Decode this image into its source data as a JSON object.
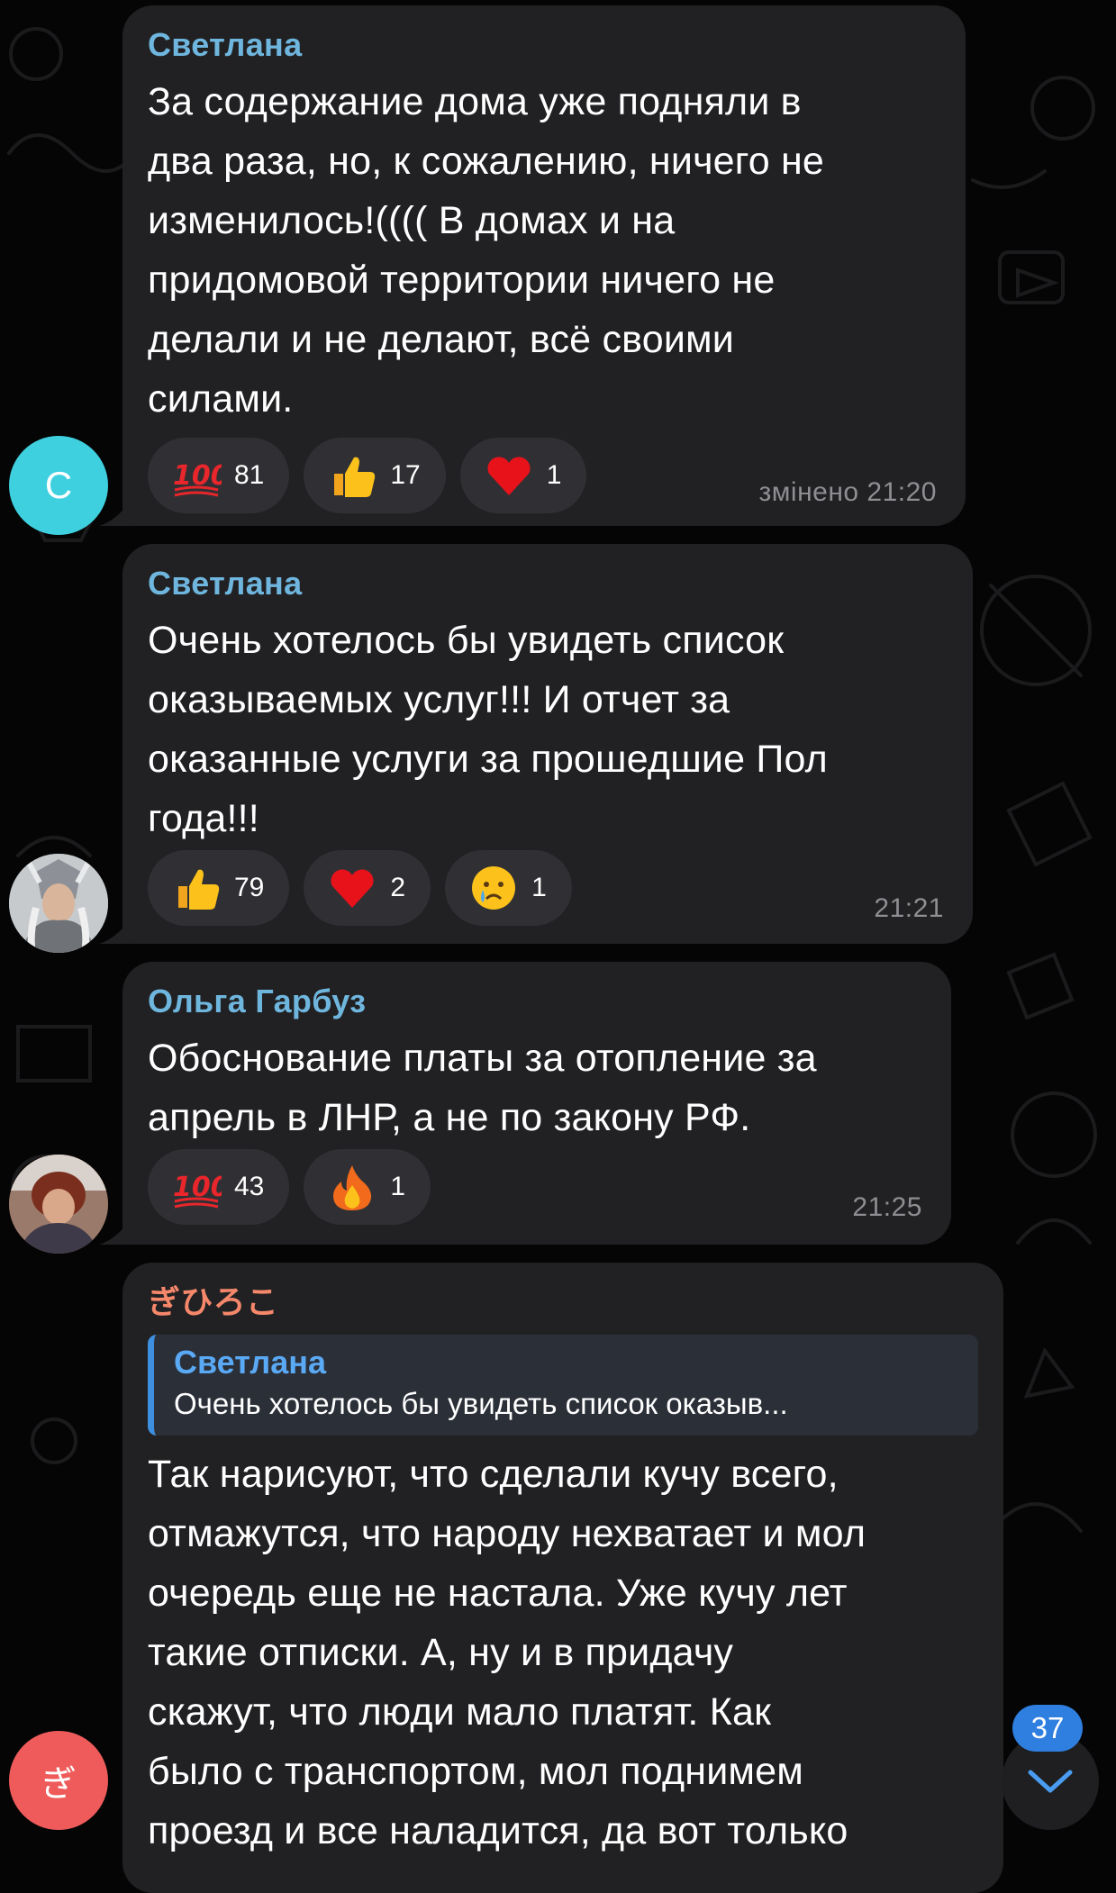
{
  "colors": {
    "background": "#050505",
    "bubble": "#212123",
    "reaction_pill": "#303034",
    "sender_blue": "#6fb6de",
    "sender_orange": "#f5876a",
    "reply_accent": "#3d8fe0",
    "badge": "#2f7fe0"
  },
  "messages": [
    {
      "sender": "Светлана",
      "sender_color": "#6fb6de",
      "lines": [
        "За содержание дома уже подняли в",
        "два раза, но, к сожалению, ничего не",
        "изменилось!(((( В домах и на",
        "придомовой территории ничего не",
        "делали и не делают, всё своими",
        "силами."
      ],
      "reactions": [
        {
          "emoji": "hundred-points-icon",
          "count": "81"
        },
        {
          "emoji": "thumbs-up-icon",
          "count": "17"
        },
        {
          "emoji": "red-heart-icon",
          "count": "1"
        }
      ],
      "time": "змінено 21:20",
      "avatar": {
        "type": "letter",
        "letter": "С",
        "color": "#3fd0e0"
      }
    },
    {
      "sender": "Светлана",
      "sender_color": "#6fb6de",
      "lines": [
        "Очень хотелось бы увидеть список",
        "оказываемых услуг!!! И отчет за",
        "оказанные услуги за прошедшие Пол",
        "года!!!"
      ],
      "reactions": [
        {
          "emoji": "thumbs-up-icon",
          "count": "79"
        },
        {
          "emoji": "red-heart-icon",
          "count": "2"
        },
        {
          "emoji": "crying-face-icon",
          "count": "1"
        }
      ],
      "time": "21:21",
      "avatar": {
        "type": "photo",
        "icon": "warrior-woman-avatar"
      }
    },
    {
      "sender": "Ольга Гарбуз",
      "sender_color": "#6fb6de",
      "lines": [
        "Обоснование платы за отопление за",
        "апрель в ЛНР, а не по закону РФ."
      ],
      "reactions": [
        {
          "emoji": "hundred-points-icon",
          "count": "43"
        },
        {
          "emoji": "fire-icon",
          "count": "1"
        }
      ],
      "time": "21:25",
      "avatar": {
        "type": "photo",
        "icon": "woman-photo-avatar"
      }
    },
    {
      "sender": "ぎひろこ",
      "sender_color": "#f5876a",
      "reply": {
        "name": "Светлана",
        "text": "Очень хотелось бы увидеть список оказыв..."
      },
      "lines": [
        "Так нарисуют, что сделали кучу всего,",
        "отмажутся, что народу нехватает и мол",
        "очередь еще не настала. Уже кучу лет",
        "такие отписки. А, ну и в придачу",
        "скажут, что люди мало платят. Как",
        "было с транспортом, мол поднимем",
        "проезд и все наладится, да вот только"
      ],
      "avatar": {
        "type": "letter",
        "letter": "ぎ",
        "color": "#ef5b5b"
      }
    }
  ],
  "unread_badge": "37",
  "scroll_button_icon": "chevron-down-icon"
}
